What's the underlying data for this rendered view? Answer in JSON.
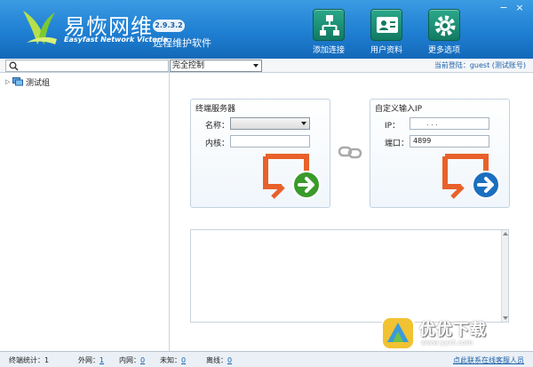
{
  "header": {
    "app_title": "易恢网维",
    "app_title_en": "Easyfast Network Victoria",
    "version": "2.9.3.2",
    "subtitle": "远程维护软件",
    "tools": [
      {
        "label": "添加连接",
        "icon": "network-tree-icon"
      },
      {
        "label": "用户资料",
        "icon": "user-profile-icon"
      },
      {
        "label": "更多选项",
        "icon": "gear-icon"
      }
    ],
    "window_controls": [
      "−",
      "×"
    ]
  },
  "toolbar": {
    "search_value": "",
    "mode_value": "完全控制",
    "login_info": "当前登陆：guest (测试账号)"
  },
  "tree": {
    "items": [
      {
        "label": "测试组",
        "expander": "▷"
      }
    ]
  },
  "terminal_panel": {
    "title": "终端服务器",
    "name_label": "名称：",
    "name_value": "",
    "kernel_label": "内核：",
    "kernel_value": ""
  },
  "custom_panel": {
    "title": "自定义输入IP",
    "ip_label": "IP：",
    "ip_dots": ".        .        .",
    "port_label": "端口：",
    "port_value": "4899"
  },
  "colors": {
    "header_blue": "#1f7fd2",
    "connect_orange": "#e8612a",
    "arrow_green": "#3a9a2a",
    "arrow_blue": "#1b6fbf"
  },
  "statusbar": {
    "terminal_label": "终端统计：",
    "terminal_value": "1",
    "wan_label": "外网：",
    "wan_value": "1",
    "lan_label": "内网：",
    "lan_value": "0",
    "unknown_label": "未知：",
    "unknown_value": "0",
    "offline_label": "离线：",
    "offline_value": "0",
    "contact": "点此联系在线客服人员"
  },
  "watermark": {
    "text": "优优下载",
    "url": "www.yyxt.com"
  }
}
